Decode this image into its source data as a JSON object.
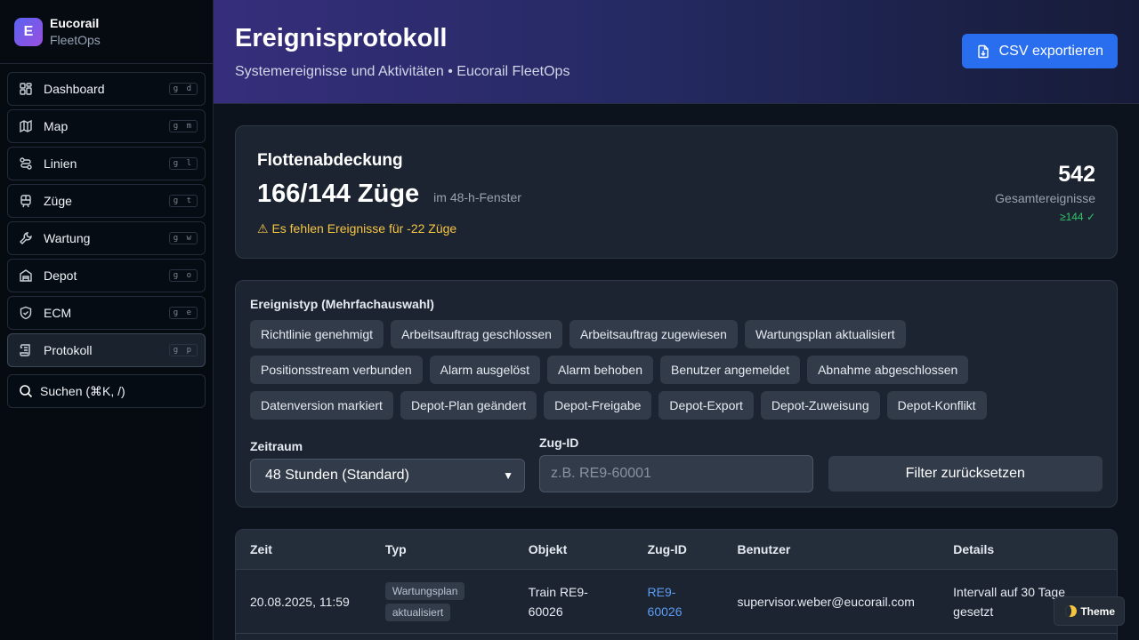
{
  "brand": {
    "logo_letter": "E",
    "name": "Eucorail",
    "sub": "FleetOps"
  },
  "nav": [
    {
      "label": "Dashboard",
      "kbd": "g d",
      "icon": "dashboard-icon",
      "active": false
    },
    {
      "label": "Map",
      "kbd": "g m",
      "icon": "map-icon",
      "active": false
    },
    {
      "label": "Linien",
      "kbd": "g l",
      "icon": "route-icon",
      "active": false
    },
    {
      "label": "Züge",
      "kbd": "g t",
      "icon": "train-icon",
      "active": false
    },
    {
      "label": "Wartung",
      "kbd": "g w",
      "icon": "wrench-icon",
      "active": false
    },
    {
      "label": "Depot",
      "kbd": "g o",
      "icon": "warehouse-icon",
      "active": false
    },
    {
      "label": "ECM",
      "kbd": "g e",
      "icon": "shield-icon",
      "active": false
    },
    {
      "label": "Protokoll",
      "kbd": "g p",
      "icon": "scroll-icon",
      "active": true
    }
  ],
  "search": {
    "label": "Suchen (⌘K, /)"
  },
  "header": {
    "title": "Ereignisprotokoll",
    "subtitle": "Systemereignisse und Aktivitäten • Eucorail FleetOps",
    "export_label": "CSV exportieren"
  },
  "coverage": {
    "title": "Flottenabdeckung",
    "value": "166/144 Züge",
    "window": "im 48-h-Fenster",
    "warning": "⚠ Es fehlen Ereignisse für -22 Züge",
    "total": "542",
    "total_label": "Gesamtereignisse",
    "check": "≥144 ✓"
  },
  "filters": {
    "type_label": "Ereignistyp (Mehrfachauswahl)",
    "chips": [
      "Richtlinie genehmigt",
      "Arbeitsauftrag geschlossen",
      "Arbeitsauftrag zugewiesen",
      "Wartungsplan aktualisiert",
      "Positionsstream verbunden",
      "Alarm ausgelöst",
      "Alarm behoben",
      "Benutzer angemeldet",
      "Abnahme abgeschlossen",
      "Datenversion markiert",
      "Depot-Plan geändert",
      "Depot-Freigabe",
      "Depot-Export",
      "Depot-Zuweisung",
      "Depot-Konflikt"
    ],
    "period_label": "Zeitraum",
    "period_value": "48 Stunden (Standard)",
    "train_label": "Zug-ID",
    "train_placeholder": "z.B. RE9-60001",
    "reset_label": "Filter zurücksetzen"
  },
  "table": {
    "headers": [
      "Zeit",
      "Typ",
      "Objekt",
      "Zug-ID",
      "Benutzer",
      "Details"
    ],
    "rows": [
      {
        "time": "20.08.2025, 11:59",
        "type": "Wartungsplan aktualisiert",
        "object": "Train RE9-60026",
        "train": "RE9-60026",
        "user": "supervisor.weber@eucorail.com",
        "details": "Intervall auf 30 Tage gesetzt"
      }
    ]
  },
  "theme": {
    "label": "Theme"
  }
}
